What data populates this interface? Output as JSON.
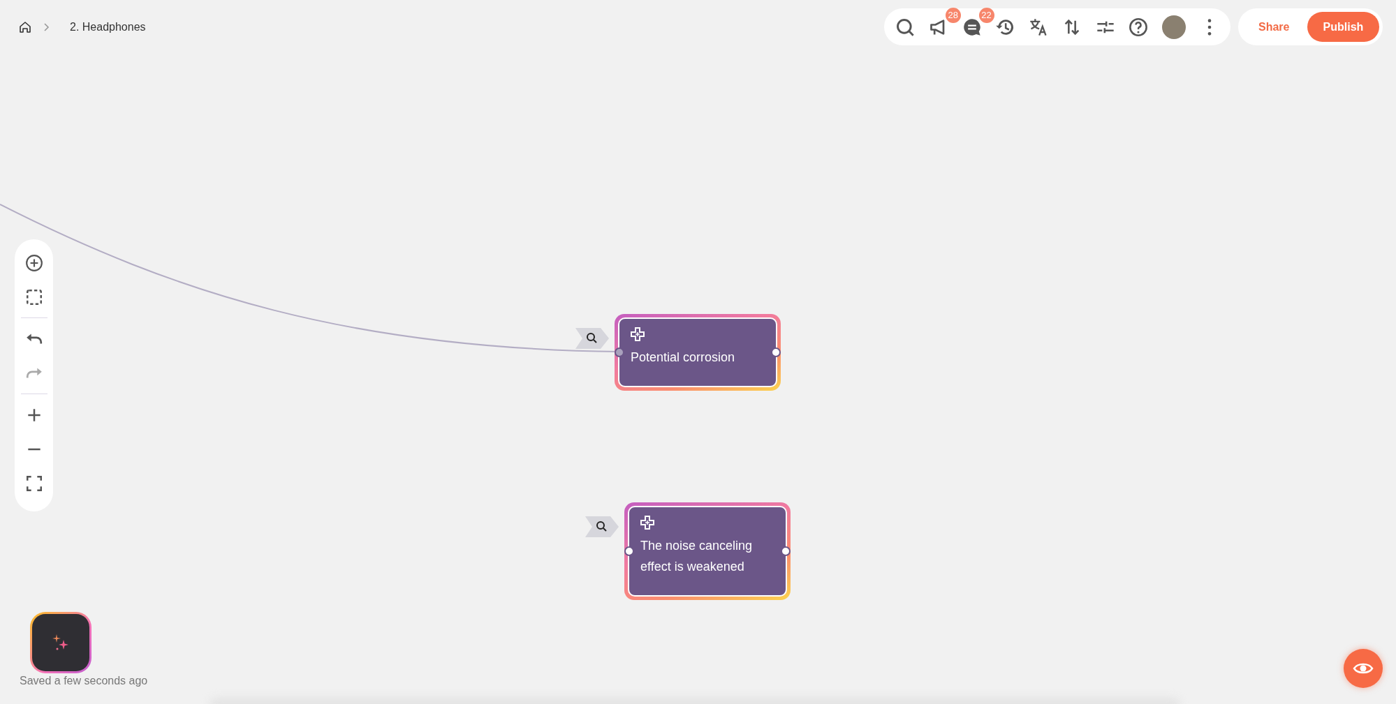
{
  "breadcrumb": {
    "title": "2. Headphones"
  },
  "toolbar": [
    {
      "kind": "search"
    },
    {
      "kind": "megaphone",
      "badge": "28"
    },
    {
      "kind": "comments",
      "badge": "22"
    },
    {
      "kind": "history"
    },
    {
      "kind": "translate"
    },
    {
      "kind": "sort"
    },
    {
      "kind": "sliders"
    },
    {
      "kind": "help"
    },
    {
      "kind": "avatar"
    },
    {
      "kind": "more"
    }
  ],
  "actions": {
    "share": "Share",
    "publish": "Publish"
  },
  "left_tools": [
    [
      {
        "kind": "add",
        "disabled": false
      },
      {
        "kind": "select",
        "disabled": false
      }
    ],
    [
      {
        "kind": "undo",
        "disabled": false
      },
      {
        "kind": "redo",
        "disabled": true
      }
    ],
    [
      {
        "kind": "zoom_in",
        "disabled": false
      },
      {
        "kind": "zoom_out",
        "disabled": false
      },
      {
        "kind": "fit",
        "disabled": false
      }
    ]
  ],
  "nodes": [
    {
      "text": "Potential corrosion",
      "left_connected": true
    },
    {
      "text": "The noise canceling effect is weakened",
      "left_connected": false
    }
  ],
  "status": "Saved a few seconds ago"
}
